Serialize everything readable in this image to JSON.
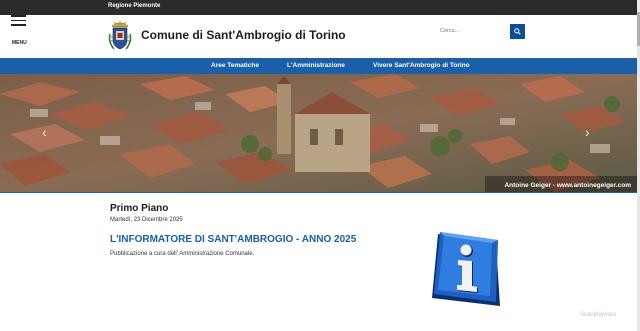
{
  "topbar": {
    "region": "Regione Piemonte"
  },
  "header": {
    "menu_label": "MENU",
    "site_title": "Comune di Sant'Ambrogio di Torino",
    "search_placeholder": "Cerca..."
  },
  "nav": {
    "items": [
      {
        "label": "Aree Tematiche"
      },
      {
        "label": "L'Amministrazione"
      },
      {
        "label": "Vivere Sant'Ambrogio di Torino"
      }
    ]
  },
  "hero": {
    "caption": "Antoine Geiger - www.antoinegeiger.com",
    "prev_icon": "chevron-left-icon",
    "next_icon": "chevron-right-icon"
  },
  "main": {
    "section_title": "Primo Piano",
    "date": "Martedì, 23 Dicembre 2025",
    "headline": "L'INFORMATORE DI SANT'AMBROGIO - ANNO 2025",
    "summary": "Pubblicazione a cura dell' Amministrazione Comunale."
  },
  "watermark": "ScanMalware",
  "colors": {
    "topbar": "#2b2b2b",
    "nav": "#1a5fa8",
    "accent": "#0b4f9c",
    "headline": "#1a5fa8"
  }
}
